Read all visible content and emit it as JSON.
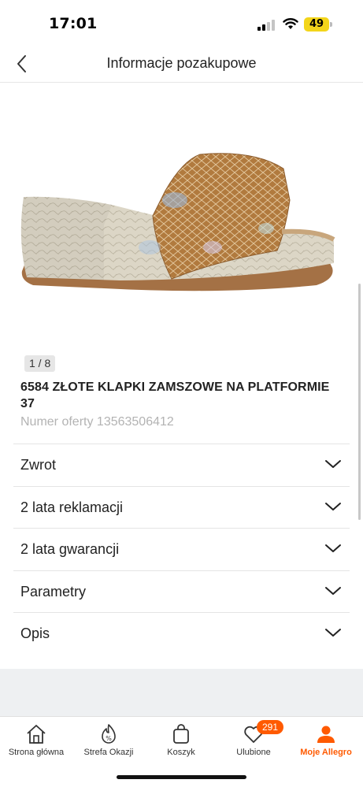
{
  "status_bar": {
    "time": "17:01",
    "battery": "49",
    "icons": [
      "signal-icon",
      "wifi-icon",
      "battery-icon"
    ]
  },
  "header": {
    "title": "Informacje pozakupowe",
    "back_icon": "chevron-left-icon"
  },
  "product": {
    "image_counter": "1 / 8",
    "title": "6584 ZŁOTE KLAPKI ZAMSZOWE NA PLATFORMIE 37",
    "offer_number": "Numer oferty 13563506412"
  },
  "accordion": [
    {
      "label": "Zwrot",
      "icon": "chevron-down-icon"
    },
    {
      "label": "2 lata reklamacji",
      "icon": "chevron-down-icon"
    },
    {
      "label": "2 lata gwarancji",
      "icon": "chevron-down-icon"
    },
    {
      "label": "Parametry",
      "icon": "chevron-down-icon"
    },
    {
      "label": "Opis",
      "icon": "chevron-down-icon"
    }
  ],
  "bottom_nav": [
    {
      "label": "Strona główna",
      "icon": "home-icon"
    },
    {
      "label": "Strefa Okazji",
      "icon": "percent-flame-icon"
    },
    {
      "label": "Koszyk",
      "icon": "cart-bag-icon"
    },
    {
      "label": "Ulubione",
      "icon": "heart-icon",
      "badge": "291"
    },
    {
      "label": "Moje Allegro",
      "icon": "user-icon",
      "active": true
    }
  ],
  "colors": {
    "accent": "#ff5a00",
    "battery": "#f3d51a",
    "muted_text": "#b3b3b3",
    "divider": "#e5e5e5",
    "band": "#eef0f2"
  }
}
